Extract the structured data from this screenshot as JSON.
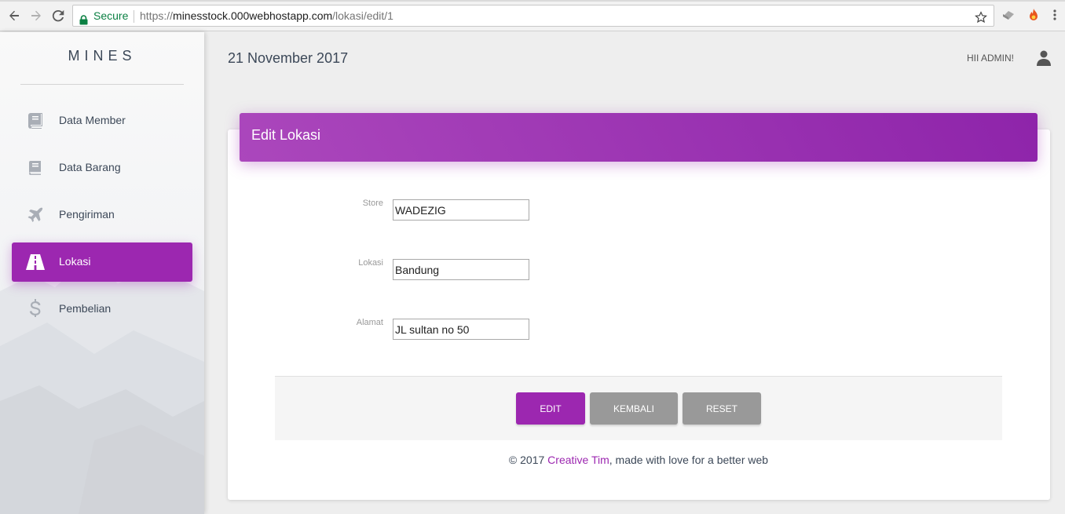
{
  "browser": {
    "secure_label": "Secure",
    "url_proto": "https://",
    "url_host": "minesstock.000webhostapp.com",
    "url_path": "/lokasi/edit/1"
  },
  "sidebar": {
    "brand": "MINES",
    "items": [
      {
        "label": "Data Member",
        "icon": "book-icon"
      },
      {
        "label": "Data Barang",
        "icon": "book-icon"
      },
      {
        "label": "Pengiriman",
        "icon": "airplane-icon"
      },
      {
        "label": "Lokasi",
        "icon": "road-icon",
        "active": true
      },
      {
        "label": "Pembelian",
        "icon": "dollar-icon"
      }
    ]
  },
  "header": {
    "date": "21 November 2017",
    "greeting": "HII ADMIN!"
  },
  "card": {
    "title": "Edit Lokasi",
    "fields": [
      {
        "label": "Store",
        "value": "WADEZIG"
      },
      {
        "label": "Lokasi",
        "value": "Bandung"
      },
      {
        "label": "Alamat",
        "value": "JL sultan no 50"
      }
    ],
    "buttons": {
      "edit": "EDIT",
      "kembali": "KEMBALI",
      "reset": "RESET"
    }
  },
  "footer": {
    "prefix": "© 2017 ",
    "link": "Creative Tim",
    "suffix": ", made with love for a better web"
  },
  "colors": {
    "accent": "#9c27b0",
    "secondary_button": "#999999",
    "secure_green": "#0b8043"
  }
}
